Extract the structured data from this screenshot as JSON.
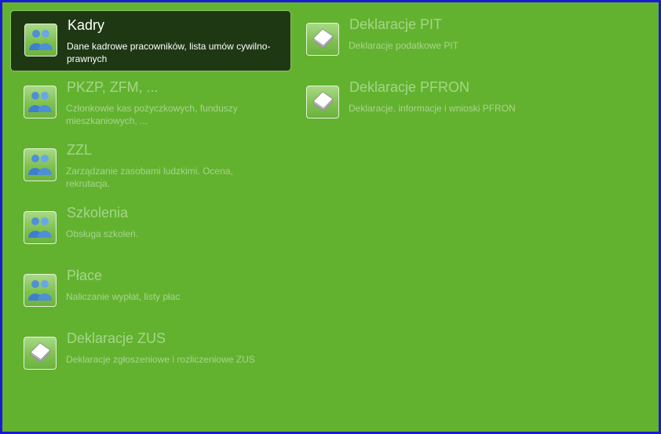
{
  "tiles": [
    {
      "title": "Kadry",
      "description": "Dane kadrowe pracowników, lista umów cywilno-prawnych",
      "icon": "people-icon",
      "selected": true
    },
    {
      "title": "PKZP, ZFM, ...",
      "description": "Członkowie kas pożyczkowych, funduszy mieszkaniowych, ...",
      "icon": "people-icon"
    },
    {
      "title": "ZZL",
      "description": "Zarządzanie zasobami ludzkimi. Ocena, rekrutacja.",
      "icon": "people-icon"
    },
    {
      "title": "Szkolenia",
      "description": "Obsługa szkoleń.",
      "icon": "people-icon"
    },
    {
      "title": "Płace",
      "description": "Naliczanie wypłat, listy płac",
      "icon": "people-icon"
    },
    {
      "title": "Deklaracje ZUS",
      "description": "Deklaracje zgłoszeniowe i rozliczeniowe ZUS",
      "icon": "documents-icon"
    },
    {
      "title": "Deklaracje PIT",
      "description": "Deklaracje podatkowe PIT",
      "icon": "documents-icon"
    },
    {
      "title": "Deklaracje PFRON",
      "description": "Deklaracje, informacje i wnioski PFRON",
      "icon": "documents-icon"
    }
  ],
  "colors": {
    "background": "#62b22f",
    "border": "#1a1ad4",
    "selected_background": "#1f3814"
  }
}
